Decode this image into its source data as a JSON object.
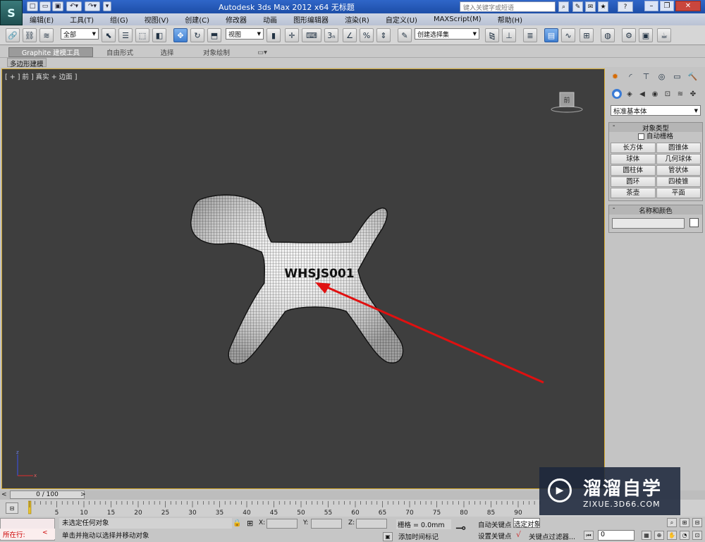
{
  "titlebar": {
    "logo": "S",
    "title": "Autodesk 3ds Max  2012 x64      无标题",
    "search_placeholder": "键入关键字或短语",
    "quick_access_icons": [
      "new-icon",
      "open-icon",
      "save-icon",
      "undo-icon",
      "redo-icon",
      "dropdown-icon"
    ],
    "help_icon": "?"
  },
  "menubar": {
    "items": [
      "编辑(E)",
      "工具(T)",
      "组(G)",
      "视图(V)",
      "创建(C)",
      "修改器",
      "动画",
      "图形编辑器",
      "渲染(R)",
      "自定义(U)",
      "MAXScript(M)",
      "帮助(H)"
    ]
  },
  "toolbar": {
    "selection_filter": "全部",
    "reference_coord": "视图",
    "named_selection": "创建选择集"
  },
  "ribbon": {
    "tabs": [
      "Graphite 建模工具",
      "自由形式",
      "选择",
      "对象绘制"
    ],
    "sub_label": "多边形建模"
  },
  "viewport": {
    "label": "[ + ] 前 ] 真实 + 边面 ]",
    "viewcube_label": "前",
    "model_text": "WHSJS001"
  },
  "command_panel": {
    "dropdown_value": "标准基本体",
    "object_type_header": "对象类型",
    "autogrid_label": "自动栅格",
    "object_buttons": [
      "长方体",
      "圆锥体",
      "球体",
      "几何球体",
      "圆柱体",
      "管状体",
      "圆环",
      "四棱锥",
      "茶壶",
      "平面"
    ],
    "name_color_header": "名称和颜色"
  },
  "timeline": {
    "frame_display": "0 / 100",
    "ticks": [
      "5",
      "10",
      "15",
      "20",
      "25",
      "30",
      "35",
      "40",
      "45",
      "50",
      "55",
      "60",
      "65",
      "70",
      "75",
      "80",
      "85",
      "90"
    ]
  },
  "status": {
    "maxscript_label": "所在行:",
    "line1": "未选定任何对象",
    "line2": "单击并拖动以选择并移动对象",
    "x_label": "X:",
    "y_label": "Y:",
    "z_label": "Z:",
    "grid_text": "栅格 = 0.0mm",
    "add_time_tag": "添加时间标记",
    "auto_key": "自动关键点",
    "selected_obj": "选定对象",
    "set_key": "设置关键点",
    "key_filters": "关键点过滤器...",
    "frame_value": "0"
  },
  "watermark": {
    "title": "溜溜自学",
    "subtitle": "ZIXUE.3D66.COM"
  }
}
